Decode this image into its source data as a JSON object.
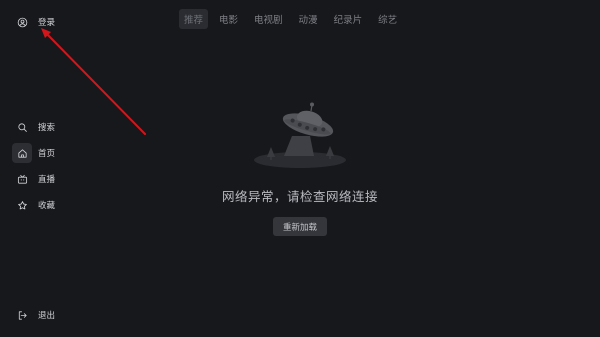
{
  "sidebar": {
    "login_label": "登录",
    "items": [
      {
        "label": "搜索",
        "icon": "search-icon"
      },
      {
        "label": "首页",
        "icon": "home-icon",
        "active": true
      },
      {
        "label": "直播",
        "icon": "tv-icon"
      },
      {
        "label": "收藏",
        "icon": "star-icon"
      }
    ],
    "logout_label": "退出"
  },
  "tabs": [
    {
      "label": "推荐",
      "active": true
    },
    {
      "label": "电影"
    },
    {
      "label": "电视剧"
    },
    {
      "label": "动漫"
    },
    {
      "label": "纪录片"
    },
    {
      "label": "综艺"
    }
  ],
  "error": {
    "message": "网络异常，请检查网络连接",
    "reload_label": "重新加载",
    "illustration": "ufo-icon"
  },
  "colors": {
    "background": "#17181c",
    "annotation_arrow": "#d4161b"
  }
}
